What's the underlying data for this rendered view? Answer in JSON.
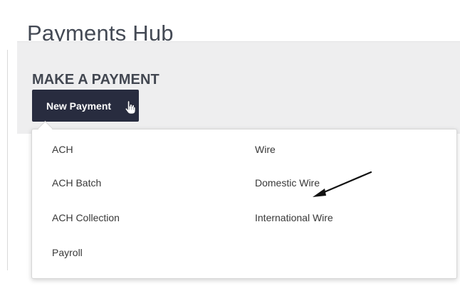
{
  "page": {
    "title": "Payments Hub"
  },
  "make_payment": {
    "heading": "MAKE A PAYMENT",
    "button_label": "New Payment",
    "icons": {
      "pointer": "hand-pointer-icon"
    }
  },
  "payment_menu": {
    "left_column": [
      "ACH",
      "ACH Batch",
      "ACH Collection",
      "Payroll"
    ],
    "right_column": [
      "Wire",
      "Domestic Wire",
      "International Wire"
    ]
  },
  "annotation": {
    "arrow_icon": "arrow-pointer-icon"
  },
  "colors": {
    "button_background": "#282c3f",
    "panel_background": "#eeeeef",
    "menu_border": "#d7d7d7"
  }
}
